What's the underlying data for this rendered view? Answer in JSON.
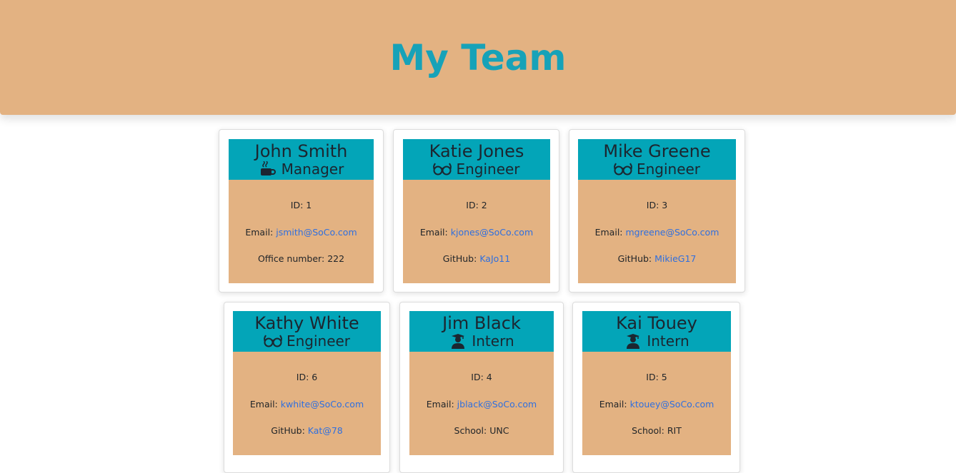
{
  "header": {
    "title": "My Team"
  },
  "labels": {
    "id": "ID:",
    "email": "Email:",
    "office": "Office number:",
    "github": "GitHub:",
    "school": "School:"
  },
  "colors": {
    "header_bg": "#e3b282",
    "title": "#17a2b8",
    "card_head": "#03a5b8",
    "card_body": "#e3b282",
    "link": "#2f6fdf"
  },
  "employees": [
    {
      "name": "John Smith",
      "role": "Manager",
      "icon": "coffee-icon",
      "id": "1",
      "email": "jsmith@SoCo.com",
      "extra_label": "Office number:",
      "extra_value": "222"
    },
    {
      "name": "Katie Jones",
      "role": "Engineer",
      "icon": "glasses-icon",
      "id": "2",
      "email": "kjones@SoCo.com",
      "extra_label": "GitHub:",
      "extra_value": "KaJo11"
    },
    {
      "name": "Mike Greene",
      "role": "Engineer",
      "icon": "glasses-icon",
      "id": "3",
      "email": "mgreene@SoCo.com",
      "extra_label": "GitHub:",
      "extra_value": "MikieG17"
    },
    {
      "name": "Kathy White",
      "role": "Engineer",
      "icon": "glasses-icon",
      "id": "6",
      "email": "kwhite@SoCo.com",
      "extra_label": "GitHub:",
      "extra_value": "Kat@78"
    },
    {
      "name": "Jim Black",
      "role": "Intern",
      "icon": "graduate-icon",
      "id": "4",
      "email": "jblack@SoCo.com",
      "extra_label": "School:",
      "extra_value": "UNC"
    },
    {
      "name": "Kai Touey",
      "role": "Intern",
      "icon": "graduate-icon",
      "id": "5",
      "email": "ktouey@SoCo.com",
      "extra_label": "School:",
      "extra_value": "RIT"
    }
  ]
}
